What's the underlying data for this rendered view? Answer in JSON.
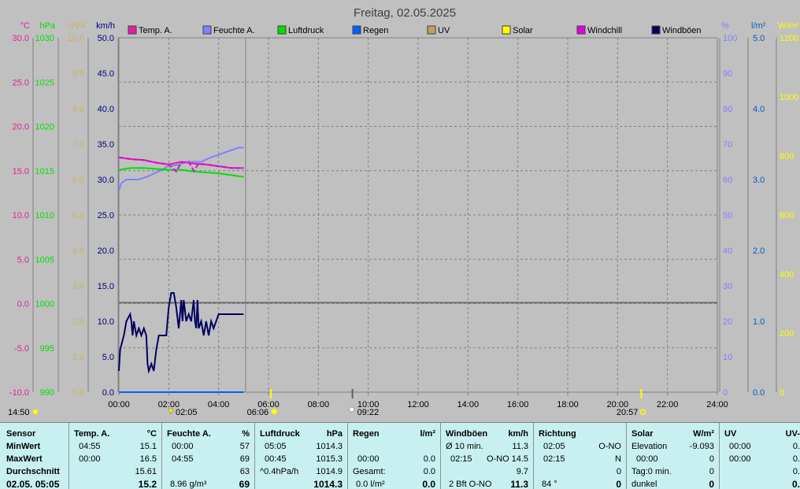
{
  "title": "Freitag, 02.05.2025",
  "colors": {
    "temp": "#e020a0",
    "humidity": "#8080ff",
    "pressure": "#00e000",
    "rain": "#0060ff",
    "uv": "#c0a060",
    "solar": "#ffff00",
    "windchill": "#e000e0",
    "gusts": "#000060",
    "wind_axis": "#000080",
    "uv_axis": "#d0b060",
    "rain_axis": "#0060c0"
  },
  "axes": {
    "temp": {
      "unit": "°C",
      "ticks": [
        "30.0",
        "25.0",
        "20.0",
        "15.0",
        "10.0",
        "5.0",
        "0.0",
        "-5.0",
        "-10.0"
      ]
    },
    "pressure": {
      "unit": "hPa",
      "ticks": [
        "1030",
        "1025",
        "1020",
        "1015",
        "1010",
        "1005",
        "1000",
        "995",
        "990"
      ]
    },
    "uv": {
      "unit": "UV4",
      "ticks": [
        "10.0",
        "9.0",
        "8.0",
        "7.0",
        "6.0",
        "5.0",
        "4.0",
        "3.0",
        "2.0",
        "1.0",
        "0.0"
      ]
    },
    "wind": {
      "unit": "km/h",
      "ticks": [
        "50.0",
        "45.0",
        "40.0",
        "35.0",
        "30.0",
        "25.0",
        "20.0",
        "15.0",
        "10.0",
        "5.0",
        "0.0"
      ]
    },
    "humidity": {
      "unit": "%",
      "ticks": [
        "100",
        "90",
        "80",
        "70",
        "60",
        "50",
        "40",
        "30",
        "20",
        "10",
        "0"
      ]
    },
    "rain": {
      "unit": "l/m²",
      "ticks": [
        "5.0",
        "4.0",
        "3.0",
        "2.0",
        "1.0",
        "0.0"
      ]
    },
    "solar": {
      "unit": "W/m²",
      "ticks": [
        "1200",
        "1000",
        "800",
        "600",
        "400",
        "200",
        "0"
      ]
    },
    "x_ticks": [
      "00:00",
      "02:00",
      "04:00",
      "06:00",
      "08:00",
      "10:00",
      "12:00",
      "14:00",
      "16:00",
      "18:00",
      "20:00",
      "22:00",
      "24:00"
    ]
  },
  "legend": [
    "Temp. A.",
    "Feuchte A.",
    "Luftdruck",
    "Regen",
    "UV",
    "Solar",
    "Windchill",
    "Windböen"
  ],
  "markers": {
    "moonrise": "14:50",
    "moonset": "02:05",
    "sunrise": "06:06",
    "moon_phase": "09:22",
    "sunset": "20:57"
  },
  "chart_data": {
    "type": "line",
    "x_unit": "hours",
    "xlim": [
      0,
      24
    ],
    "series": [
      {
        "name": "Temp. A.",
        "axis": "°C",
        "x": [
          0,
          0.5,
          1,
          1.5,
          2,
          2.5,
          3,
          3.5,
          4,
          4.5,
          5
        ],
        "values": [
          16.5,
          16.3,
          16.2,
          15.9,
          15.7,
          16.0,
          15.8,
          15.7,
          15.5,
          15.3,
          15.3
        ]
      },
      {
        "name": "Feuchte A.",
        "axis": "%",
        "x": [
          0,
          0.1,
          0.3,
          0.5,
          0.8,
          1.2,
          1.5,
          1.8,
          2.0,
          2.3,
          2.7,
          3.0,
          3.3,
          3.6,
          4.0,
          4.4,
          4.8,
          5.0
        ],
        "values": [
          57,
          59,
          60,
          60,
          60,
          61,
          62,
          63,
          64,
          64,
          65,
          65,
          65,
          66,
          67,
          68,
          69,
          69
        ]
      },
      {
        "name": "Luftdruck",
        "axis": "hPa",
        "x": [
          0,
          0.5,
          1,
          1.5,
          2,
          2.5,
          3,
          3.5,
          4,
          4.5,
          5
        ],
        "values": [
          1015.1,
          1015.3,
          1015.3,
          1015.2,
          1015.1,
          1015.1,
          1014.9,
          1014.8,
          1014.7,
          1014.5,
          1014.3
        ]
      },
      {
        "name": "Windchill",
        "axis": "°C",
        "x": [
          0,
          0.5,
          1,
          1.5,
          2,
          2.3,
          2.5,
          2.8,
          3,
          3.2,
          3.5,
          4,
          4.5,
          5
        ],
        "values": [
          16.5,
          16.3,
          16.2,
          15.9,
          15.7,
          14.9,
          15.9,
          16.0,
          15.0,
          15.8,
          15.7,
          15.5,
          15.3,
          15.3
        ],
        "dash": true
      },
      {
        "name": "Windböen",
        "axis": "km/h",
        "x": [
          0,
          0.05,
          0.2,
          0.3,
          0.45,
          0.5,
          0.55,
          0.6,
          0.7,
          0.8,
          0.9,
          1.0,
          1.1,
          1.15,
          1.2,
          1.3,
          1.4,
          1.5,
          1.6,
          1.75,
          1.9,
          2.0,
          2.1,
          2.2,
          2.3,
          2.4,
          2.5,
          2.55,
          2.6,
          2.7,
          2.8,
          2.9,
          3.0,
          3.05,
          3.1,
          3.15,
          3.2,
          3.3,
          3.4,
          3.5,
          3.6,
          3.7,
          3.8,
          3.9,
          4.0,
          4.2,
          4.4,
          4.6,
          4.8,
          5.0
        ],
        "values": [
          3,
          6,
          8,
          10,
          11,
          10,
          8,
          10,
          8,
          9,
          8,
          9,
          8,
          4,
          3,
          4,
          3,
          6,
          8,
          8,
          8,
          12,
          14,
          14,
          12,
          9,
          13,
          10,
          13,
          10,
          11,
          10,
          13,
          10,
          9,
          13,
          9,
          10,
          8,
          10,
          8,
          10,
          9,
          10,
          11,
          11,
          11,
          11,
          11,
          11
        ]
      },
      {
        "name": "Regen",
        "axis": "l/m²",
        "x": [
          0,
          5
        ],
        "values": [
          0,
          0
        ]
      }
    ],
    "rain_total": "0.0",
    "reference_line": {
      "axis": "hPa",
      "value": 1000.1
    }
  },
  "table": {
    "sensor": {
      "h": "Sensor",
      "r1": "MinWert",
      "r2": "MaxWert",
      "r3": "Durchschnitt",
      "r4": "02.05. 05:05"
    },
    "temp": {
      "h": "Temp. A.",
      "unit": "°C",
      "min_t": "04:55",
      "min_v": "15.1",
      "max_t": "00:00",
      "max_v": "16.5",
      "avg": "15.61",
      "cur": "15.2"
    },
    "hum": {
      "h": "Feuchte A.",
      "unit": "%",
      "min_t": "00:00",
      "min_v": "57",
      "max_t": "04:55",
      "max_v": "69",
      "avg": "63",
      "abs": "8.96 g/m³",
      "cur": "69"
    },
    "press": {
      "h": "Luftdruck",
      "unit": "hPa",
      "min_t": "05:05",
      "min_v": "1014.3",
      "max_t": "00:45",
      "max_v": "1015.3",
      "trend": "^0.4hPa/h",
      "trend_v": "1014.9",
      "cur": "1014.3"
    },
    "rain": {
      "h": "Regen",
      "unit": "l/m²",
      "max_t": "00:00",
      "max_v": "0.0",
      "total_l": "Gesamt:",
      "total_v": "0.0",
      "cur_l": "0.0 l/m²",
      "cur": "0.0"
    },
    "gust": {
      "h": "Windböen",
      "unit": "km/h",
      "r1_l": "Ø 10 min.",
      "r1_v": "11.3",
      "r2_t": "02:15",
      "r2_d": "O-NO",
      "r2_v": "14.5",
      "r3_v": "9.7",
      "r4_l": "2 Bft O-NO",
      "cur": "11.3"
    },
    "dir": {
      "h": "Richtung",
      "r1_t": "02:05",
      "r1_v": "O-NO",
      "r2_t": "02:15",
      "r2_v": "N",
      "r3_v": "0",
      "r4_l": "84 °",
      "cur": "0"
    },
    "solar": {
      "h": "Solar",
      "unit": "W/m²",
      "r1_l": "Elevation",
      "r1_v": "-9.093",
      "r2_t": "00:00",
      "r2_v": "0",
      "r3_l": "Tag:0 min.",
      "r3_v": "0",
      "r4_l": "dunkel",
      "cur": "0"
    },
    "uv": {
      "h": "UV",
      "unit": "UV-",
      "r1_t": "00:00",
      "r1_v": "0.",
      "r2_t": "00:00",
      "r2_v": "0.",
      "r3_v": "0.",
      "cur": "0."
    }
  }
}
